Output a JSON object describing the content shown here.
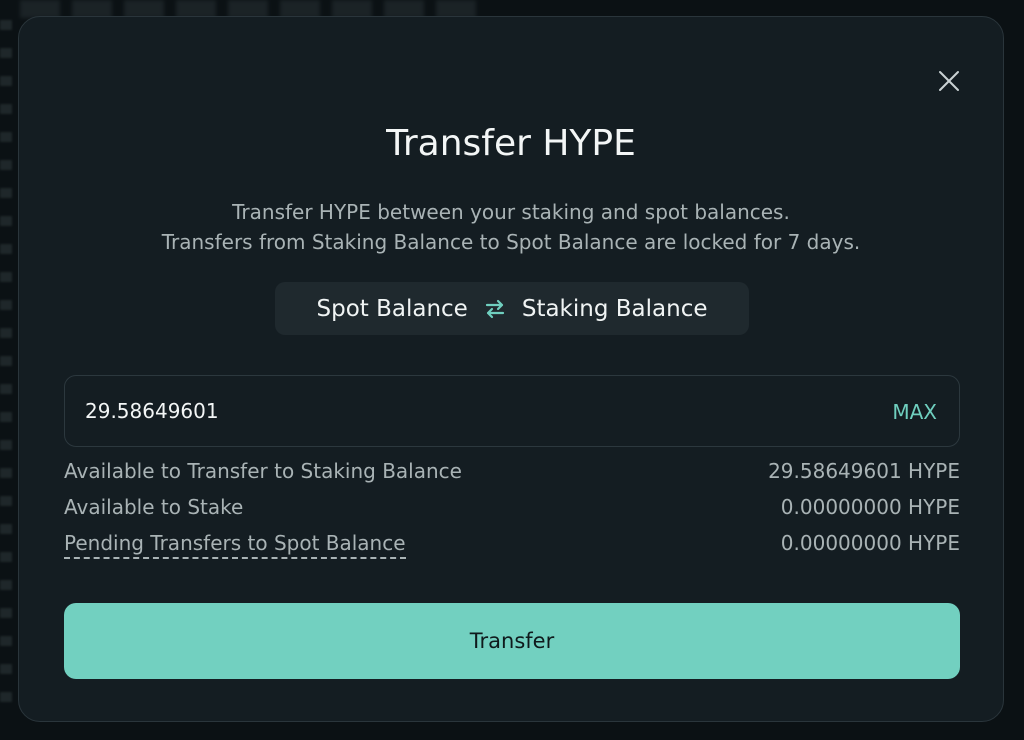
{
  "modal": {
    "title": "Transfer HYPE",
    "subtitle_line1": "Transfer HYPE between your staking and spot balances.",
    "subtitle_line2": "Transfers from Staking Balance to Spot Balance are locked for 7 days."
  },
  "toggle": {
    "from_label": "Spot Balance",
    "to_label": "Staking Balance",
    "icon": "swap-arrows-icon"
  },
  "amount": {
    "value": "29.58649601",
    "max_label": "MAX"
  },
  "info": [
    {
      "label": "Available to Transfer to Staking Balance",
      "value": "29.58649601 HYPE"
    },
    {
      "label": "Available to Stake",
      "value": "0.00000000 HYPE"
    },
    {
      "label": "Pending Transfers to Spot Balance",
      "value": "0.00000000 HYPE"
    }
  ],
  "actions": {
    "transfer_label": "Transfer",
    "close_icon": "close-icon"
  },
  "colors": {
    "accent": "#72d0c0",
    "background": "#141d22",
    "text": "#f3f6f6",
    "muted": "#a9b3b5"
  }
}
